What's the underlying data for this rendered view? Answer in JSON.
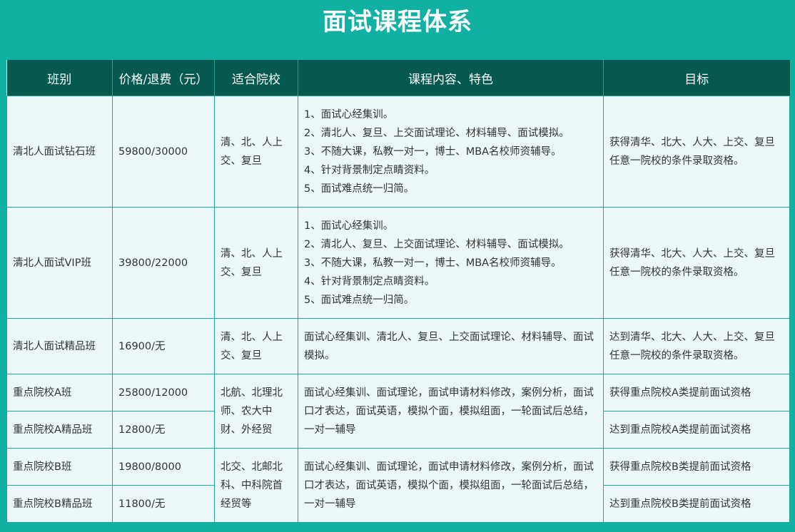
{
  "title": "面试课程体系",
  "headers": {
    "class": "班别",
    "price": "价格/退费（元）",
    "school": "适合院校",
    "content": "课程内容、特色",
    "goal": "目标"
  },
  "rows": [
    {
      "name": "清北人面试钻石班",
      "price": "59800/30000",
      "school": "清、北、人上交、复旦",
      "content_lines": [
        "1、面试心经集训。",
        "2、清北人、复旦、上交面试理论、材料辅导、面试模拟。",
        "3、不随大课，私教一对一，博士、MBA名校师资辅导。",
        "4、针对背景制定点睛资料。",
        "5、面试难点统一归简。"
      ],
      "goal": "获得清华、北大、人大、上交、复旦任意一院校的条件录取资格。"
    },
    {
      "name": "清北人面试VIP班",
      "price": "39800/22000",
      "school": "清、北、人上交、复旦",
      "content_lines": [
        "1、面试心经集训。",
        "2、清北人、复旦、上交面试理论、材料辅导、面试模拟。",
        "3、不随大课，私教一对一，博士、MBA名校师资辅导。",
        "4、针对背景制定点睛资料。",
        "5、面试难点统一归简。"
      ],
      "goal": "获得清华、北大、人大、上交、复旦任意一院校的条件录取资格。"
    },
    {
      "name": "清北人面试精品班",
      "price": "16900/无",
      "school": "清、北、人上交、复旦",
      "content": "面试心经集训、清北人、复旦、上交面试理论、材料辅导、面试模拟。",
      "goal": "达到清华、北大、人大、上交、复旦任意一院校的条件录取资格。"
    },
    {
      "name": "重点院校A班",
      "price": "25800/12000",
      "goal": "获得重点院校A类提前面试资格"
    },
    {
      "name": "重点院校A精品班",
      "price": "12800/无",
      "goal": "达到重点院校A类提前面试资格"
    },
    {
      "name": "重点院校B班",
      "price": "19800/8000",
      "goal": "获得重点院校B类提前面试资格"
    },
    {
      "name": "重点院校B精品班",
      "price": "11800/无",
      "goal": "达到重点院校B类提前面试资格"
    }
  ],
  "groupA": {
    "school": "北航、北理北师、农大中财、外经贸",
    "content": "面试心经集训、面试理论，面试申请材料修改，案例分析，面试口才表达，面试英语，模拟个面，模拟组面，一轮面试后总结，一对一辅导"
  },
  "groupB": {
    "school": "北交、北邮北科、中科院首经贸等",
    "content": "面试心经集训、面试理论，面试申请材料修改，案例分析，面试口才表达，面试英语，模拟个面，模拟组面，一轮面试后总结，一对一辅导"
  }
}
